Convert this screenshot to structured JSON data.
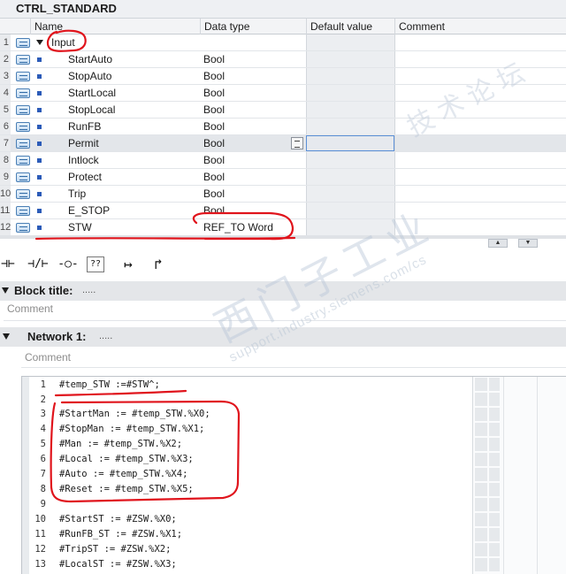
{
  "block": {
    "title": "CTRL_STANDARD"
  },
  "interface": {
    "columns": {
      "name": "Name",
      "data_type": "Data type",
      "default_value": "Default value",
      "comment": "Comment"
    },
    "rows": [
      {
        "num": "1",
        "name": "Input",
        "type": "",
        "section": true
      },
      {
        "num": "2",
        "name": "StartAuto",
        "type": "Bool"
      },
      {
        "num": "3",
        "name": "StopAuto",
        "type": "Bool"
      },
      {
        "num": "4",
        "name": "StartLocal",
        "type": "Bool"
      },
      {
        "num": "5",
        "name": "StopLocal",
        "type": "Bool"
      },
      {
        "num": "6",
        "name": "RunFB",
        "type": "Bool"
      },
      {
        "num": "7",
        "name": "Permit",
        "type": "Bool",
        "selected": true
      },
      {
        "num": "8",
        "name": "Intlock",
        "type": "Bool"
      },
      {
        "num": "9",
        "name": "Protect",
        "type": "Bool"
      },
      {
        "num": "10",
        "name": "Trip",
        "type": "Bool"
      },
      {
        "num": "11",
        "name": "E_STOP",
        "type": "Bool"
      },
      {
        "num": "12",
        "name": "STW",
        "type": "REF_TO Word"
      }
    ]
  },
  "toolbar": {
    "no_contact": "⊣⊢",
    "nc_contact": "⊣/⊢",
    "coil": "-○-",
    "empty_box": "??",
    "open_branch": "↦",
    "close_branch": "↱"
  },
  "block_title": {
    "label": "Block title:",
    "dots": ".....",
    "comment": "Comment"
  },
  "network": {
    "label": "Network 1:",
    "dots": ".....",
    "comment": "Comment"
  },
  "code": [
    {
      "ln": "1",
      "src": "#temp_STW :=#STW^;"
    },
    {
      "ln": "2",
      "src": ""
    },
    {
      "ln": "3",
      "src": "#StartMan := #temp_STW.%X0;"
    },
    {
      "ln": "4",
      "src": "#StopMan := #temp_STW.%X1;"
    },
    {
      "ln": "5",
      "src": "#Man := #temp_STW.%X2;"
    },
    {
      "ln": "6",
      "src": "#Local := #temp_STW.%X3;"
    },
    {
      "ln": "7",
      "src": "#Auto := #temp_STW.%X4;"
    },
    {
      "ln": "8",
      "src": "#Reset := #temp_STW.%X5;"
    },
    {
      "ln": "9",
      "src": ""
    },
    {
      "ln": "10",
      "src": "#StartST := #ZSW.%X0;"
    },
    {
      "ln": "11",
      "src": "#RunFB_ST := #ZSW.%X1;"
    },
    {
      "ln": "12",
      "src": "#TripST := #ZSW.%X2;"
    },
    {
      "ln": "13",
      "src": "#LocalST := #ZSW.%X3;"
    }
  ],
  "watermark": {
    "main": "西门子工业",
    "tail": "技术论坛",
    "url": "support.industry.siemens.com/cs"
  },
  "colors": {
    "annotation": "#e0141c",
    "bit_marker": "#2b5bb8",
    "header_bg": "#f3f4f6"
  }
}
